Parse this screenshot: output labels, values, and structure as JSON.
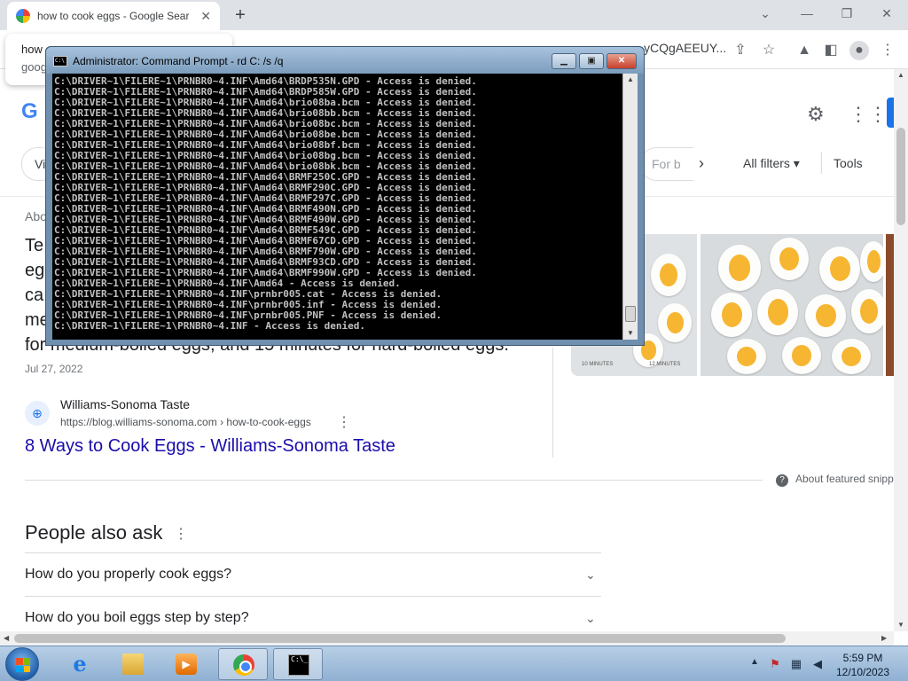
{
  "browser": {
    "tab_title": "how to cook eggs - Google Sear",
    "tab_close": "✕",
    "new_tab": "+",
    "win_min": "—",
    "win_restore": "❐",
    "win_close": "✕",
    "win_down": "⌄",
    "omnibox_dropdown": {
      "line1": "how",
      "line2": "goog"
    },
    "url_tail": "yCQgAEEUY..."
  },
  "google": {
    "logo": "G",
    "chip_left": "Vi",
    "chip_right": "For b",
    "all_filters": "All filters ▾",
    "tools": "Tools",
    "about_left": "Abo",
    "snippet_lines": [
      "Te",
      "eg",
      "ca",
      "me",
      "for medium-boiled eggs, and 15 minutes for hard-boiled eggs."
    ],
    "date": "Jul 27, 2022",
    "site_name": "Williams-Sonoma Taste",
    "site_url": "https://blog.williams-sonoma.com › how-to-cook-eggs",
    "site_more": "⋮",
    "result_title": "8 Ways to Cook Eggs - Williams-Sonoma Taste",
    "img_cap1": "10 MINUTES",
    "img_cap2": "12 MINUTES",
    "about_snippets": "About featured snipp",
    "paa_title": "People also ask",
    "paa_more": "⋮",
    "paa_questions": [
      "How do you properly cook eggs?",
      "How do you boil eggs step by step?"
    ]
  },
  "cmd": {
    "icon_text": "C:\\",
    "title": "Administrator:  Command Prompt - rd  C: /s /q",
    "lines": [
      "C:\\DRIVER~1\\FILERE~1\\PRNBR0~4.INF\\Amd64\\BRDP535N.GPD - Access is denied.",
      "C:\\DRIVER~1\\FILERE~1\\PRNBR0~4.INF\\Amd64\\BRDP585W.GPD - Access is denied.",
      "C:\\DRIVER~1\\FILERE~1\\PRNBR0~4.INF\\Amd64\\brio08ba.bcm - Access is denied.",
      "C:\\DRIVER~1\\FILERE~1\\PRNBR0~4.INF\\Amd64\\brio08bb.bcm - Access is denied.",
      "C:\\DRIVER~1\\FILERE~1\\PRNBR0~4.INF\\Amd64\\brio08bc.bcm - Access is denied.",
      "C:\\DRIVER~1\\FILERE~1\\PRNBR0~4.INF\\Amd64\\brio08be.bcm - Access is denied.",
      "C:\\DRIVER~1\\FILERE~1\\PRNBR0~4.INF\\Amd64\\brio08bf.bcm - Access is denied.",
      "C:\\DRIVER~1\\FILERE~1\\PRNBR0~4.INF\\Amd64\\brio08bg.bcm - Access is denied.",
      "C:\\DRIVER~1\\FILERE~1\\PRNBR0~4.INF\\Amd64\\brio08bk.bcm - Access is denied.",
      "C:\\DRIVER~1\\FILERE~1\\PRNBR0~4.INF\\Amd64\\BRMF250C.GPD - Access is denied.",
      "C:\\DRIVER~1\\FILERE~1\\PRNBR0~4.INF\\Amd64\\BRMF290C.GPD - Access is denied.",
      "C:\\DRIVER~1\\FILERE~1\\PRNBR0~4.INF\\Amd64\\BRMF297C.GPD - Access is denied.",
      "C:\\DRIVER~1\\FILERE~1\\PRNBR0~4.INF\\Amd64\\BRMF490N.GPD - Access is denied.",
      "C:\\DRIVER~1\\FILERE~1\\PRNBR0~4.INF\\Amd64\\BRMF490W.GPD - Access is denied.",
      "C:\\DRIVER~1\\FILERE~1\\PRNBR0~4.INF\\Amd64\\BRMF549C.GPD - Access is denied.",
      "C:\\DRIVER~1\\FILERE~1\\PRNBR0~4.INF\\Amd64\\BRMF67CD.GPD - Access is denied.",
      "C:\\DRIVER~1\\FILERE~1\\PRNBR0~4.INF\\Amd64\\BRMF790W.GPD - Access is denied.",
      "C:\\DRIVER~1\\FILERE~1\\PRNBR0~4.INF\\Amd64\\BRMF93CD.GPD - Access is denied.",
      "C:\\DRIVER~1\\FILERE~1\\PRNBR0~4.INF\\Amd64\\BRMF990W.GPD - Access is denied.",
      "C:\\DRIVER~1\\FILERE~1\\PRNBR0~4.INF\\Amd64 - Access is denied.",
      "C:\\DRIVER~1\\FILERE~1\\PRNBR0~4.INF\\prnbr005.cat - Access is denied.",
      "C:\\DRIVER~1\\FILERE~1\\PRNBR0~4.INF\\prnbr005.inf - Access is denied.",
      "C:\\DRIVER~1\\FILERE~1\\PRNBR0~4.INF\\prnbr005.PNF - Access is denied.",
      "C:\\DRIVER~1\\FILERE~1\\PRNBR0~4.INF - Access is denied."
    ]
  },
  "taskbar": {
    "term_icon_text": "C:\\_",
    "time": "5:59 PM",
    "date": "12/10/2023"
  }
}
